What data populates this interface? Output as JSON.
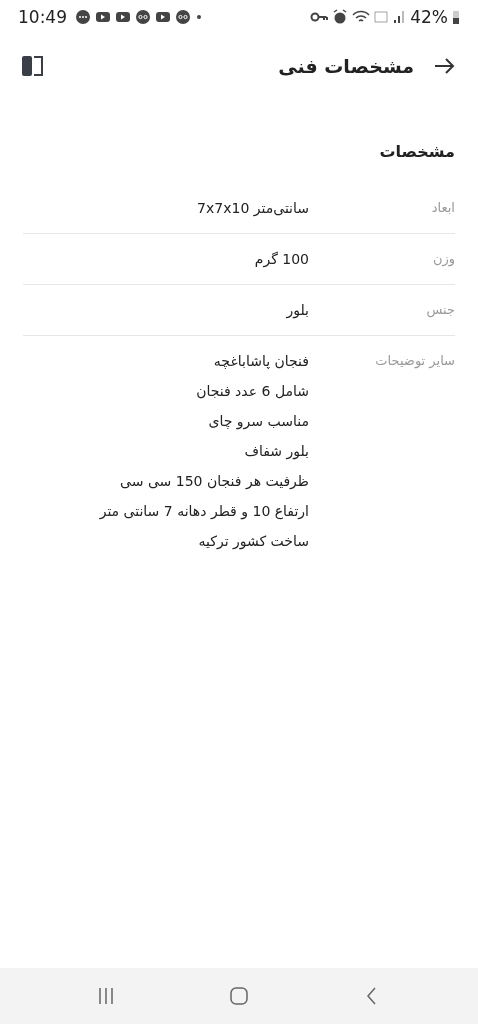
{
  "status_bar": {
    "time": "10:49",
    "battery": "42%"
  },
  "header": {
    "title": "مشخصات فنی"
  },
  "section_title": "مشخصات",
  "specs": [
    {
      "label": "ابعاد",
      "lines": [
        "سانتی‌متر 7x7x10"
      ]
    },
    {
      "label": "وزن",
      "lines": [
        "100 گرم"
      ]
    },
    {
      "label": "جنس",
      "lines": [
        "بلور"
      ]
    },
    {
      "label": "سایر توضیحات",
      "lines": [
        "فنجان پاشاباغچه",
        "شامل 6 عدد فنجان",
        "مناسب سرو چای",
        "بلور شفاف",
        "ظرفیت هر فنجان 150 سی سی",
        "ارتفاع 10 و قطر دهانه 7 سانتی متر",
        "ساخت کشور ترکیه"
      ]
    }
  ]
}
